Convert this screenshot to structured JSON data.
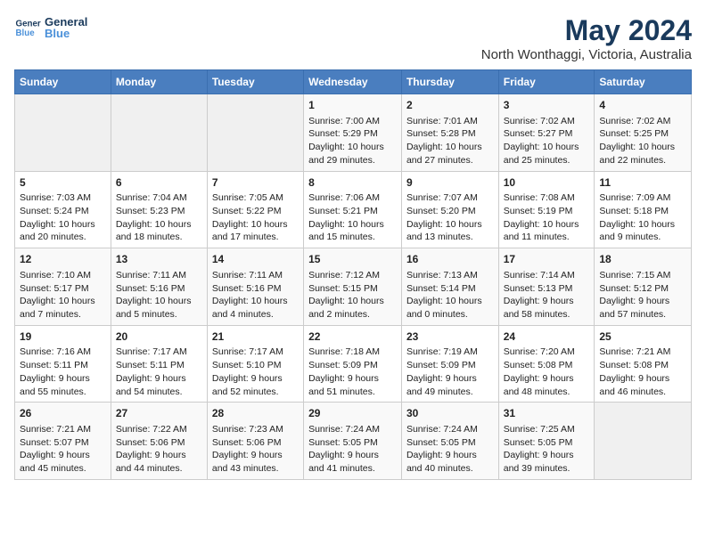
{
  "header": {
    "logo_line1": "General",
    "logo_line2": "Blue",
    "title": "May 2024",
    "subtitle": "North Wonthaggi, Victoria, Australia"
  },
  "days_of_week": [
    "Sunday",
    "Monday",
    "Tuesday",
    "Wednesday",
    "Thursday",
    "Friday",
    "Saturday"
  ],
  "weeks": [
    [
      {
        "day": "",
        "content": ""
      },
      {
        "day": "",
        "content": ""
      },
      {
        "day": "",
        "content": ""
      },
      {
        "day": "1",
        "content": "Sunrise: 7:00 AM\nSunset: 5:29 PM\nDaylight: 10 hours\nand 29 minutes."
      },
      {
        "day": "2",
        "content": "Sunrise: 7:01 AM\nSunset: 5:28 PM\nDaylight: 10 hours\nand 27 minutes."
      },
      {
        "day": "3",
        "content": "Sunrise: 7:02 AM\nSunset: 5:27 PM\nDaylight: 10 hours\nand 25 minutes."
      },
      {
        "day": "4",
        "content": "Sunrise: 7:02 AM\nSunset: 5:25 PM\nDaylight: 10 hours\nand 22 minutes."
      }
    ],
    [
      {
        "day": "5",
        "content": "Sunrise: 7:03 AM\nSunset: 5:24 PM\nDaylight: 10 hours\nand 20 minutes."
      },
      {
        "day": "6",
        "content": "Sunrise: 7:04 AM\nSunset: 5:23 PM\nDaylight: 10 hours\nand 18 minutes."
      },
      {
        "day": "7",
        "content": "Sunrise: 7:05 AM\nSunset: 5:22 PM\nDaylight: 10 hours\nand 17 minutes."
      },
      {
        "day": "8",
        "content": "Sunrise: 7:06 AM\nSunset: 5:21 PM\nDaylight: 10 hours\nand 15 minutes."
      },
      {
        "day": "9",
        "content": "Sunrise: 7:07 AM\nSunset: 5:20 PM\nDaylight: 10 hours\nand 13 minutes."
      },
      {
        "day": "10",
        "content": "Sunrise: 7:08 AM\nSunset: 5:19 PM\nDaylight: 10 hours\nand 11 minutes."
      },
      {
        "day": "11",
        "content": "Sunrise: 7:09 AM\nSunset: 5:18 PM\nDaylight: 10 hours\nand 9 minutes."
      }
    ],
    [
      {
        "day": "12",
        "content": "Sunrise: 7:10 AM\nSunset: 5:17 PM\nDaylight: 10 hours\nand 7 minutes."
      },
      {
        "day": "13",
        "content": "Sunrise: 7:11 AM\nSunset: 5:16 PM\nDaylight: 10 hours\nand 5 minutes."
      },
      {
        "day": "14",
        "content": "Sunrise: 7:11 AM\nSunset: 5:16 PM\nDaylight: 10 hours\nand 4 minutes."
      },
      {
        "day": "15",
        "content": "Sunrise: 7:12 AM\nSunset: 5:15 PM\nDaylight: 10 hours\nand 2 minutes."
      },
      {
        "day": "16",
        "content": "Sunrise: 7:13 AM\nSunset: 5:14 PM\nDaylight: 10 hours\nand 0 minutes."
      },
      {
        "day": "17",
        "content": "Sunrise: 7:14 AM\nSunset: 5:13 PM\nDaylight: 9 hours\nand 58 minutes."
      },
      {
        "day": "18",
        "content": "Sunrise: 7:15 AM\nSunset: 5:12 PM\nDaylight: 9 hours\nand 57 minutes."
      }
    ],
    [
      {
        "day": "19",
        "content": "Sunrise: 7:16 AM\nSunset: 5:11 PM\nDaylight: 9 hours\nand 55 minutes."
      },
      {
        "day": "20",
        "content": "Sunrise: 7:17 AM\nSunset: 5:11 PM\nDaylight: 9 hours\nand 54 minutes."
      },
      {
        "day": "21",
        "content": "Sunrise: 7:17 AM\nSunset: 5:10 PM\nDaylight: 9 hours\nand 52 minutes."
      },
      {
        "day": "22",
        "content": "Sunrise: 7:18 AM\nSunset: 5:09 PM\nDaylight: 9 hours\nand 51 minutes."
      },
      {
        "day": "23",
        "content": "Sunrise: 7:19 AM\nSunset: 5:09 PM\nDaylight: 9 hours\nand 49 minutes."
      },
      {
        "day": "24",
        "content": "Sunrise: 7:20 AM\nSunset: 5:08 PM\nDaylight: 9 hours\nand 48 minutes."
      },
      {
        "day": "25",
        "content": "Sunrise: 7:21 AM\nSunset: 5:08 PM\nDaylight: 9 hours\nand 46 minutes."
      }
    ],
    [
      {
        "day": "26",
        "content": "Sunrise: 7:21 AM\nSunset: 5:07 PM\nDaylight: 9 hours\nand 45 minutes."
      },
      {
        "day": "27",
        "content": "Sunrise: 7:22 AM\nSunset: 5:06 PM\nDaylight: 9 hours\nand 44 minutes."
      },
      {
        "day": "28",
        "content": "Sunrise: 7:23 AM\nSunset: 5:06 PM\nDaylight: 9 hours\nand 43 minutes."
      },
      {
        "day": "29",
        "content": "Sunrise: 7:24 AM\nSunset: 5:05 PM\nDaylight: 9 hours\nand 41 minutes."
      },
      {
        "day": "30",
        "content": "Sunrise: 7:24 AM\nSunset: 5:05 PM\nDaylight: 9 hours\nand 40 minutes."
      },
      {
        "day": "31",
        "content": "Sunrise: 7:25 AM\nSunset: 5:05 PM\nDaylight: 9 hours\nand 39 minutes."
      },
      {
        "day": "",
        "content": ""
      }
    ]
  ]
}
